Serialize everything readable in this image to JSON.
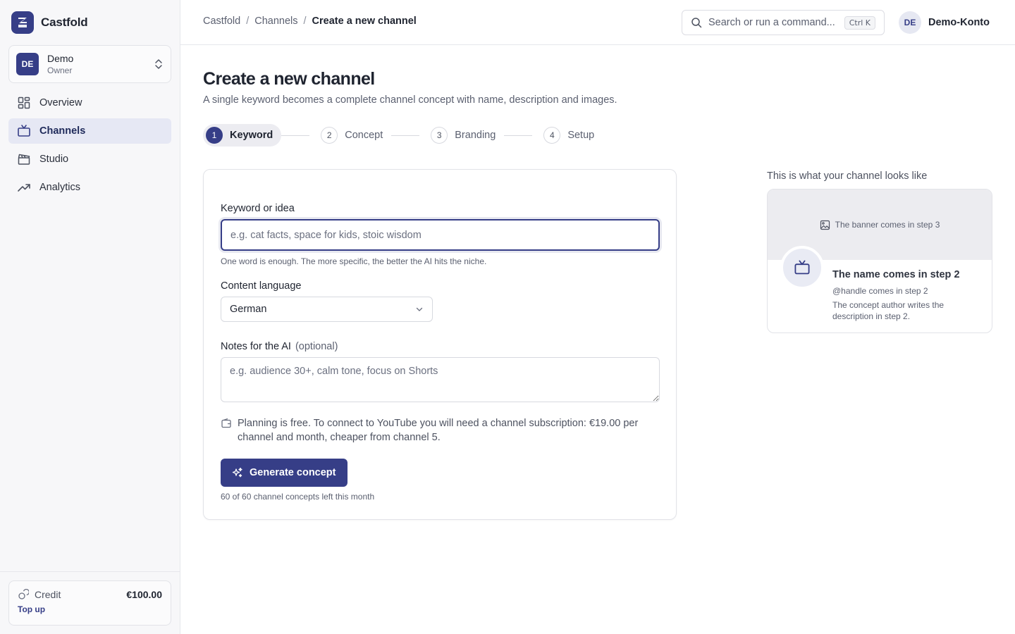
{
  "app": {
    "name": "Castfold"
  },
  "workspace": {
    "initials": "DE",
    "name": "Demo",
    "role": "Owner"
  },
  "sidebar": {
    "items": [
      {
        "label": "Overview",
        "icon": "grid-icon"
      },
      {
        "label": "Channels",
        "icon": "tv-icon",
        "active": true
      },
      {
        "label": "Studio",
        "icon": "clapperboard-icon"
      },
      {
        "label": "Analytics",
        "icon": "trending-up-icon"
      }
    ]
  },
  "credit": {
    "label": "Credit",
    "amount": "€100.00",
    "topup": "Top up"
  },
  "header": {
    "breadcrumb": [
      "Castfold",
      "Channels",
      "Create a new channel"
    ],
    "search_placeholder": "Search or run a command...",
    "search_shortcut": "Ctrl K",
    "user_initials": "DE",
    "user_name": "Demo-Konto"
  },
  "page": {
    "title": "Create a new channel",
    "subtitle": "A single keyword becomes a complete channel concept with name, description and images."
  },
  "stepper": {
    "steps": [
      {
        "num": "1",
        "label": "Keyword",
        "active": true
      },
      {
        "num": "2",
        "label": "Concept"
      },
      {
        "num": "3",
        "label": "Branding"
      },
      {
        "num": "4",
        "label": "Setup"
      }
    ]
  },
  "form": {
    "keyword_label": "Keyword or idea",
    "keyword_placeholder": "e.g. cat facts, space for kids, stoic wisdom",
    "keyword_value": "",
    "keyword_hint": "One word is enough. The more specific, the better the AI hits the niche.",
    "language_label": "Content language",
    "language_value": "German",
    "notes_label": "Notes for the AI",
    "notes_optional": "(optional)",
    "notes_placeholder": "e.g. audience 30+, calm tone, focus on Shorts",
    "notice_line1": "Planning is free. To connect to YouTube you will need a channel subscription: €19.00 per",
    "notice_line2": "channel and month, cheaper from channel 5.",
    "generate_label": "Generate concept",
    "quota": "60 of 60 channel concepts left this month"
  },
  "preview": {
    "title": "This is what your channel looks like",
    "banner_text": "The banner comes in step 3",
    "name": "The name comes in step 2",
    "handle": "@handle comes in step 2",
    "description": "The concept author writes the description in step 2."
  },
  "colors": {
    "accent": "#363e87",
    "accent_soft": "#e6e8f4",
    "sidebar_bg": "#f7f7f9"
  }
}
